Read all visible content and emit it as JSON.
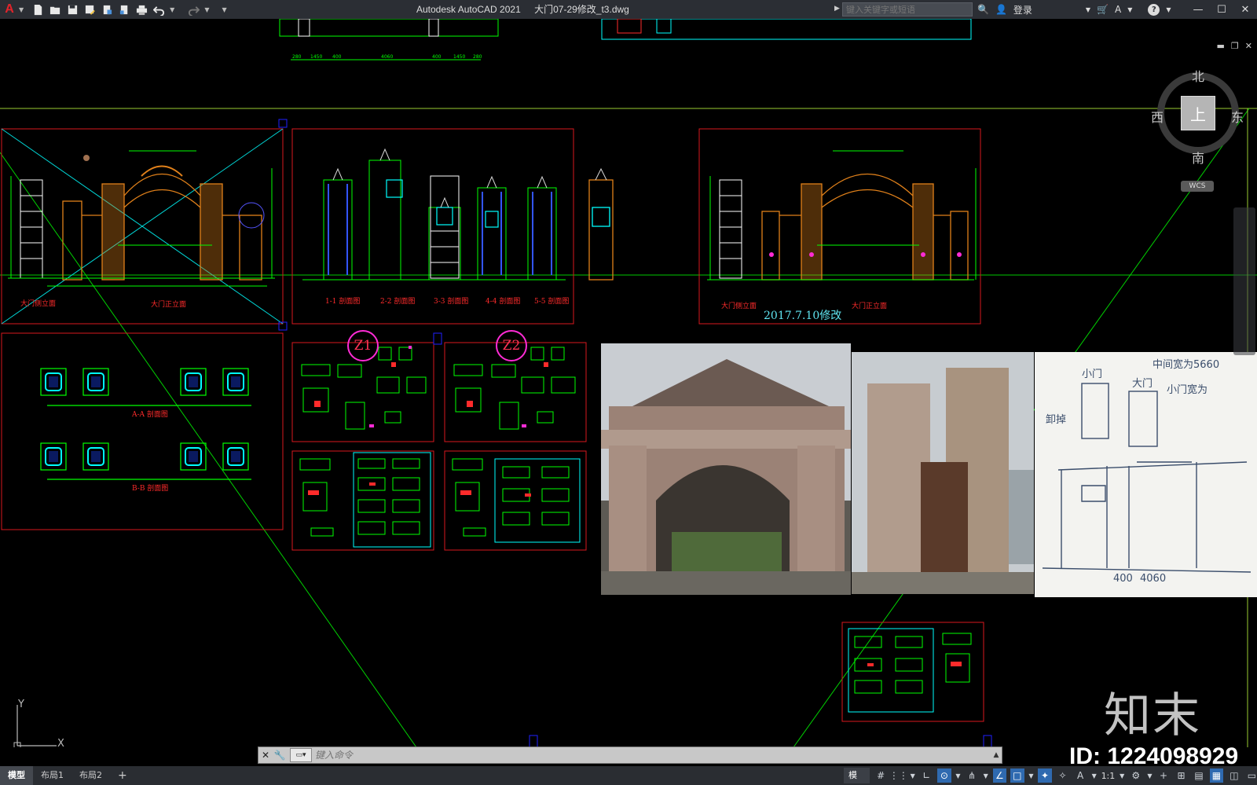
{
  "window": {
    "app_title": "Autodesk AutoCAD 2021",
    "file_name": "大门07-29修改_t3.dwg",
    "search_placeholder": "键入关键字或短语",
    "login_label": "登录",
    "help_label": "?"
  },
  "viewcube": {
    "north": "北",
    "south": "南",
    "east": "东",
    "west": "西",
    "face": "上",
    "wcs": "WCS"
  },
  "drawing": {
    "elevation_labels": [
      "大门侧立面",
      "大门正立面",
      "1-1 剖面图",
      "2-2 剖面图",
      "3-3 剖面图",
      "4-4 剖面图",
      "5-5 剖面图",
      "大门侧立面",
      "大门正立面"
    ],
    "plan_labels": [
      "A-A 剖面图",
      "B-B 剖面图"
    ],
    "revision_note": "2017.7.10修改",
    "markers": [
      "Z1",
      "Z2"
    ],
    "dims_top": [
      "280",
      "1450",
      "400",
      "4060",
      "400",
      "1450",
      "280"
    ]
  },
  "sketch": {
    "notes": [
      "中间宽为5660",
      "小门宽为",
      "小门",
      "大门",
      "卸掉",
      "400",
      "4060"
    ]
  },
  "ucs": {
    "y": "Y",
    "x": "X"
  },
  "command": {
    "placeholder": "键入命令"
  },
  "status": {
    "tabs": [
      "模型",
      "布局1",
      "布局2",
      "+"
    ],
    "model_label": "模型",
    "scale": "1:1"
  },
  "watermark": {
    "logo": "知末",
    "id": "ID: 1224098929"
  },
  "colors": {
    "frame_red": "#d9171e",
    "cad_green": "#00ff00",
    "cad_cyan": "#00ffff",
    "cad_orange": "#e0801a",
    "accent_blue": "#2f6ab0"
  }
}
